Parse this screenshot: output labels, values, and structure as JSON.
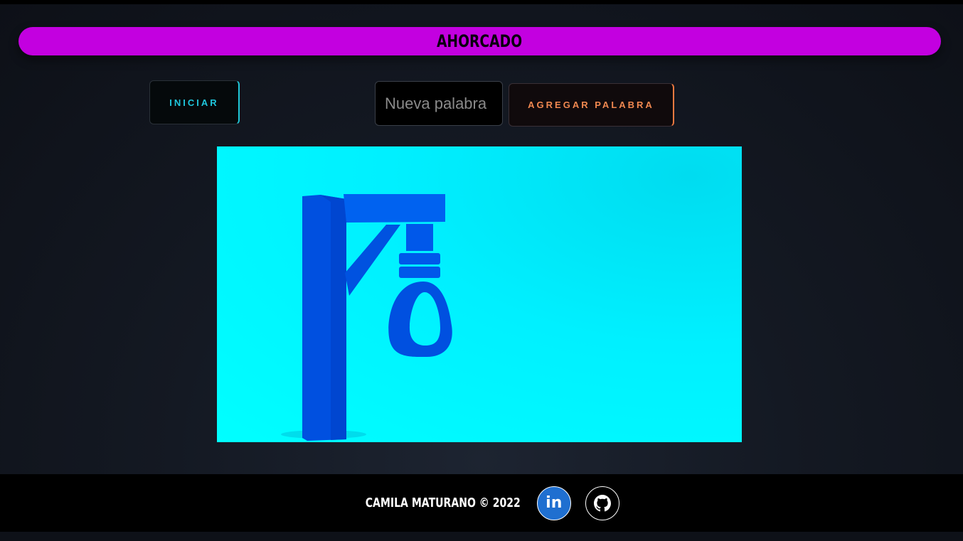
{
  "header": {
    "title": "AHORCADO"
  },
  "controls": {
    "start_label": "INICIAR",
    "new_word_placeholder": "Nueva palabra",
    "add_word_label": "AGREGAR PALABRA"
  },
  "footer": {
    "credit": "CAMILA MATURANO © 2022",
    "linkedin_text": "in",
    "links": [
      {
        "icon": "linkedin-icon"
      },
      {
        "icon": "github-icon"
      }
    ]
  },
  "colors": {
    "title_bar": "#c300e0",
    "start_text": "#1fc6dc",
    "add_text": "#f08850",
    "image_background": "#00ffff",
    "gallows": "#0057e8",
    "linkedin": "#1f6fd0"
  }
}
